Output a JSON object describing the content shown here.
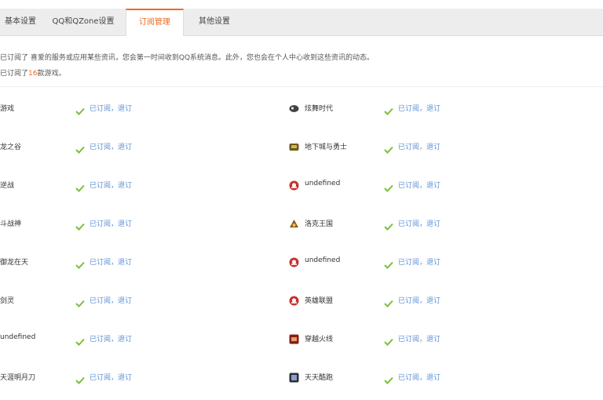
{
  "tabs": [
    {
      "label": "基本设置"
    },
    {
      "label": "QQ和QZone设置"
    },
    {
      "label": "订阅管理",
      "active": true
    },
    {
      "label": "其他设置"
    }
  ],
  "notice": {
    "line1": "已订阅了 喜爱的服务或应用某些资讯，您会第一时间收到QQ系统消息。此外，您也会在个人中心收到这些资讯的动态。",
    "line2_prefix": "已订阅了",
    "line2_count": "16",
    "line2_suffix": "款游戏。"
  },
  "status_text": "已订阅，退订",
  "colors": {
    "accent": "#f06a1d",
    "check": "#7cbf3a",
    "link": "#5b8fd6"
  },
  "left_items": [
    {
      "name": "游戏",
      "icon": "none"
    },
    {
      "name": "龙之谷",
      "icon": "none"
    },
    {
      "name": "逆战",
      "icon": "none"
    },
    {
      "name": "斗战神",
      "icon": "none"
    },
    {
      "name": "御龙在天",
      "icon": "none"
    },
    {
      "name": "剑灵",
      "icon": "none"
    },
    {
      "name": "undefined",
      "icon": "none"
    },
    {
      "name": "天涯明月刀",
      "icon": "none"
    }
  ],
  "right_items": [
    {
      "name": "炫舞时代",
      "icon": "game-icon-1"
    },
    {
      "name": "地下城与勇士",
      "icon": "game-icon-2"
    },
    {
      "name": "undefined",
      "icon": "red-circle-icon"
    },
    {
      "name": "洛克王国",
      "icon": "game-icon-3"
    },
    {
      "name": "undefined",
      "icon": "red-circle-icon"
    },
    {
      "name": "英雄联盟",
      "icon": "red-circle-icon"
    },
    {
      "name": "穿越火线",
      "icon": "game-icon-4"
    },
    {
      "name": "天天酷跑",
      "icon": "game-icon-5"
    }
  ]
}
